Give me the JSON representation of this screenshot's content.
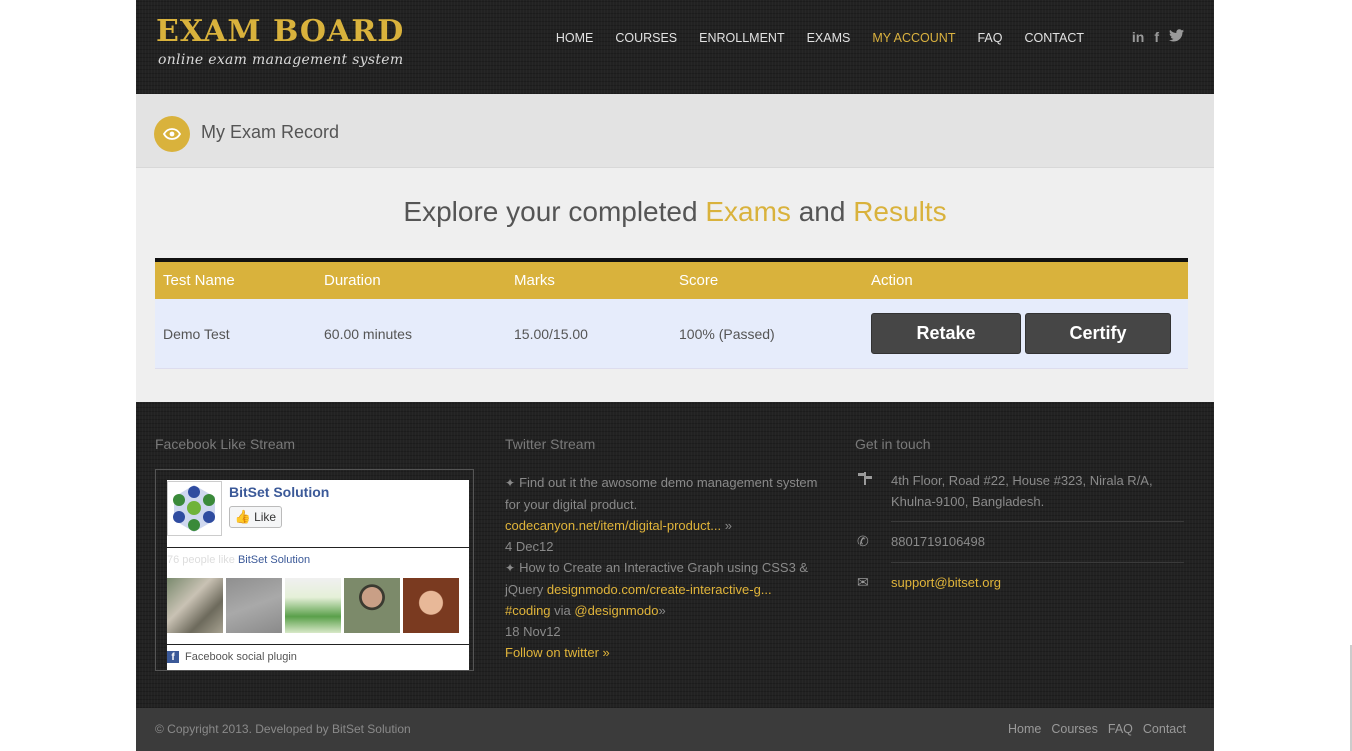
{
  "brand": {
    "title": "EXAM BOARD",
    "tagline": "online exam management system",
    "accent_color": "#d9b23c"
  },
  "nav": [
    {
      "label": "HOME",
      "active": false
    },
    {
      "label": "COURSES",
      "active": false
    },
    {
      "label": "ENROLLMENT",
      "active": false
    },
    {
      "label": "EXAMS",
      "active": false
    },
    {
      "label": "MY ACCOUNT",
      "active": true
    },
    {
      "label": "FAQ",
      "active": false
    },
    {
      "label": "CONTACT",
      "active": false
    }
  ],
  "social": {
    "linkedin": "in",
    "facebook": "f",
    "twitter": "twitter-icon"
  },
  "page_title": "My Exam Record",
  "headline": {
    "part1": "Explore your completed",
    "accent1": "Exams",
    "part2": "and",
    "accent2": "Results"
  },
  "table": {
    "headers": [
      "Test Name",
      "Duration",
      "Marks",
      "Score",
      "Action"
    ],
    "rows": [
      {
        "name": "Demo Test",
        "duration": "60.00 minutes",
        "marks": "15.00/15.00",
        "score": "100% (Passed)",
        "retake": "Retake",
        "certify": "Certify"
      }
    ]
  },
  "footer": {
    "facebook": {
      "title": "Facebook Like Stream",
      "page_name": "BitSet Solution",
      "like_label": "Like",
      "count_text": "76 people like",
      "count_link": "BitSet Solution",
      "plugin_label": "Facebook social plugin"
    },
    "twitter": {
      "title": "Twitter Stream",
      "t1_text": "Find out it the awosome demo management system for your digital product.",
      "t1_link": "codecanyon.net/item/digital-product...",
      "t1_date": "4 Dec12",
      "t2_text": "How to Create an Interactive Graph using CSS3 & jQuery",
      "t2_link": "designmodo.com/create-interactive-g...",
      "t2_tag": "#coding",
      "t2_via": "via",
      "t2_user": "@designmodo",
      "t2_date": "18 Nov12",
      "follow": "Follow on twitter »"
    },
    "contact": {
      "title": "Get in touch",
      "address": "4th Floor, Road #22, House #323, Nirala R/A, Khulna-9100, Bangladesh.",
      "phone": "8801719106498",
      "email": "support@bitset.org"
    }
  },
  "bottom": {
    "copyright": "© Copyright 2013. Developed by BitSet Solution",
    "links": [
      "Home",
      "Courses",
      "FAQ",
      "Contact"
    ]
  }
}
